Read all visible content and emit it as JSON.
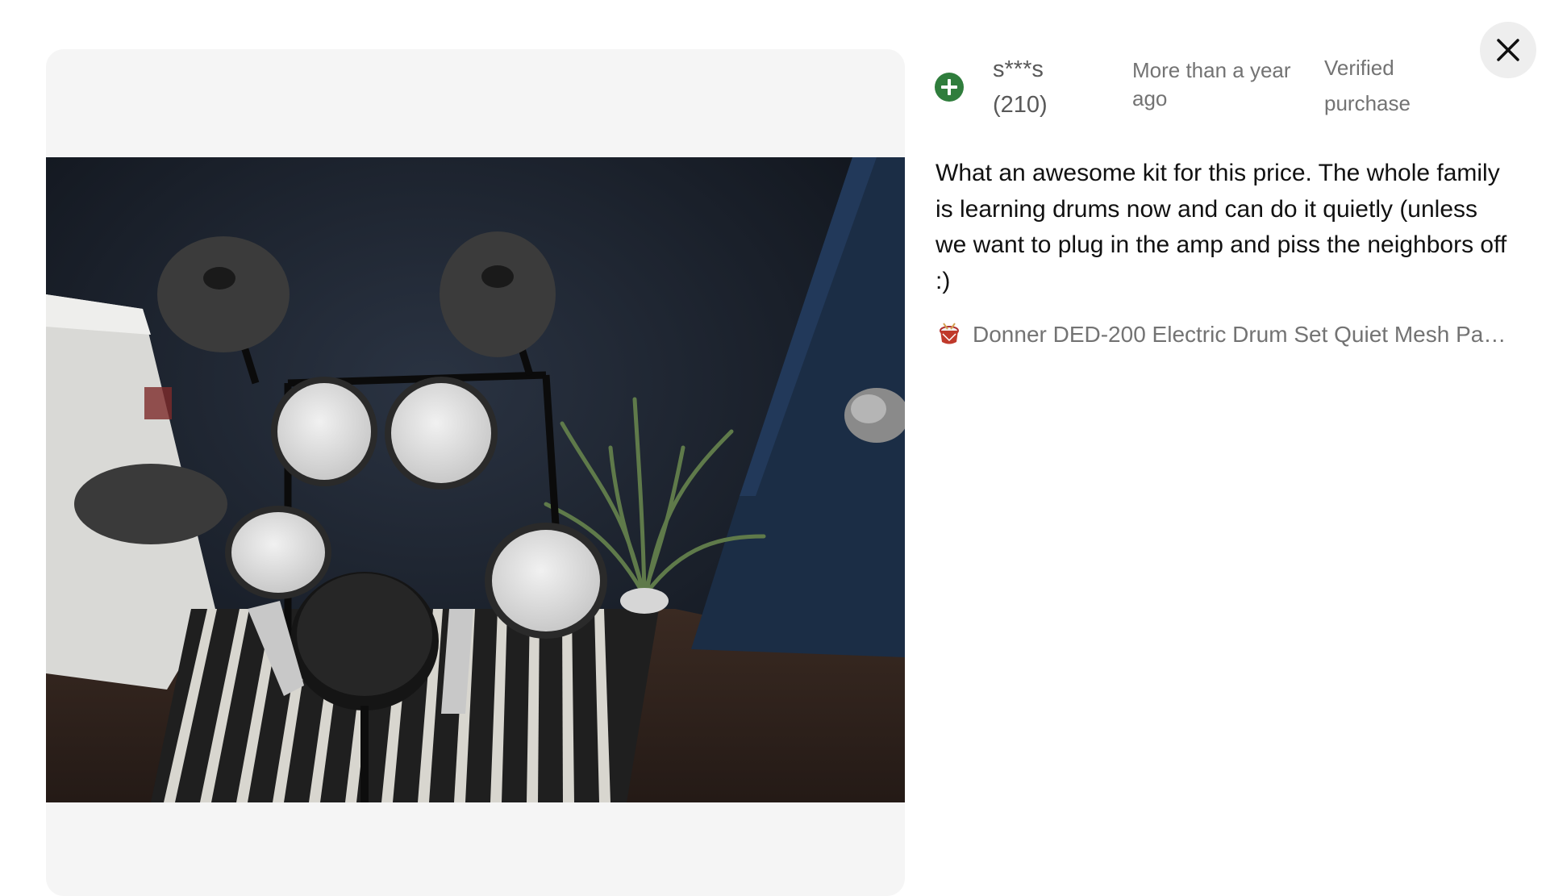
{
  "reviewer": {
    "name": "s***s",
    "review_count": "(210)",
    "avatar_icon": "plus-circle-icon",
    "avatar_color": "#2f7d3c"
  },
  "review": {
    "date": "More than a year ago",
    "badge": "Verified purchase",
    "text": "What an awesome kit for this price. The whole family is learning drums now and can do it quietly (unless we want to plug in the amp and piss the neighbors off :)"
  },
  "product": {
    "name": "Donner DED-200 Electric Drum Set Quiet Mesh Pads…",
    "thumb_icon": "drum-icon"
  },
  "controls": {
    "close_icon": "close-icon"
  },
  "photo": {
    "subject": "electric-drum-kit-photo"
  }
}
